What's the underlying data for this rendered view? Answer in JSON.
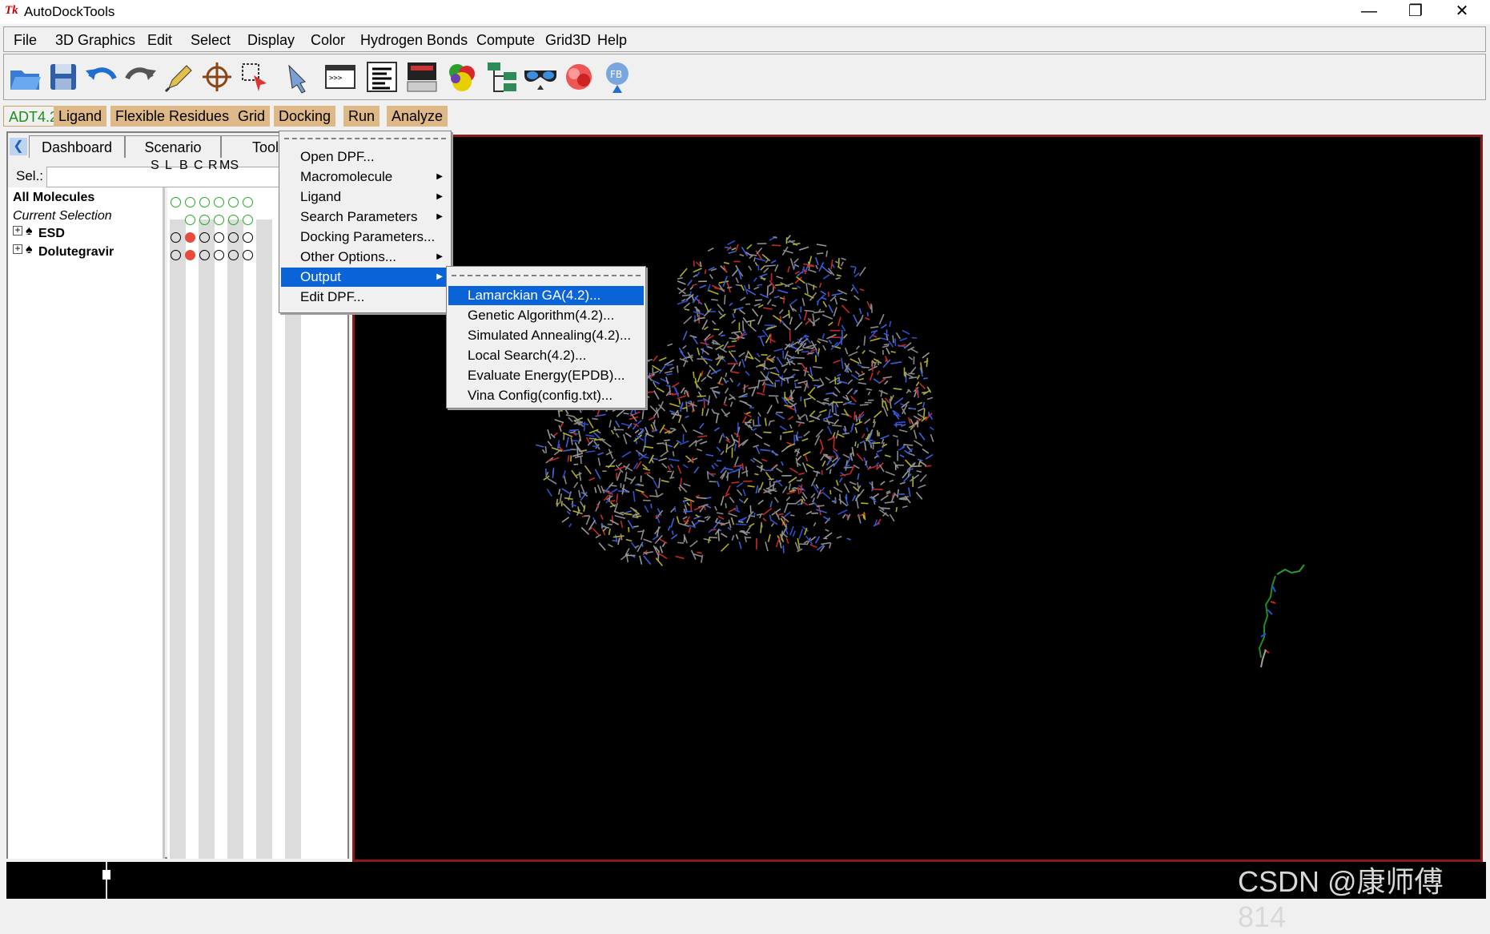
{
  "window": {
    "title": "AutoDockTools",
    "icon": "Tk",
    "minimize": "—",
    "maximize": "❐",
    "close": "✕"
  },
  "menubar": [
    "File",
    "3D Graphics",
    "Edit",
    "Select",
    "Display",
    "Color",
    "Hydrogen Bonds",
    "Compute",
    "Grid3D",
    "Help"
  ],
  "toolbar_icons": [
    "open-folder-icon",
    "save-icon",
    "undo-icon",
    "redo-icon",
    "pencil-icon",
    "target-icon",
    "select-icon",
    "hand-pick-icon",
    "python-shell-icon",
    "text-lines-icon",
    "monitor-icon",
    "color-balls-icon",
    "tree-icon",
    "stereo-glasses-icon",
    "spin-icon",
    "info-icon"
  ],
  "adt_tabs": [
    "ADT4.2",
    "Ligand",
    "Flexible Residues",
    "Grid",
    "Docking",
    "Run",
    "Analyze"
  ],
  "dashboard": {
    "tabs": [
      "Dashboard",
      "Scenario",
      "Tools"
    ],
    "sel_label": "Sel.:",
    "sel_value": "",
    "column_headers": [
      "S",
      "L",
      "B",
      "C",
      "R",
      "MS"
    ],
    "rows": [
      {
        "label": "All Molecules",
        "style": "bold"
      },
      {
        "label": "Current Selection",
        "style": "italic"
      },
      {
        "label": "ESD",
        "style": "bold",
        "expander": "+"
      },
      {
        "label": "Dolutegravir",
        "style": "bold",
        "expander": "+"
      }
    ]
  },
  "docking_menu": {
    "items": [
      "Open DPF...",
      "Macromolecule",
      "Ligand",
      "Search Parameters",
      "Docking Parameters...",
      "Other Options...",
      "Output",
      "Edit DPF..."
    ],
    "selected": "Output"
  },
  "output_submenu": {
    "items": [
      "Lamarckian GA(4.2)...",
      "Genetic Algorithm(4.2)...",
      "Simulated Annealing(4.2)...",
      "Local Search(4.2)...",
      "Evaluate Energy(EPDB)...",
      "Vina Config(config.txt)..."
    ],
    "selected": "Lamarckian GA(4.2)..."
  },
  "watermark": "CSDN @康师傅814",
  "colors": {
    "accent": "#0a64d8",
    "adt_tab_bg": "#deb887",
    "viewer_border": "#8b1a1a",
    "viewer_bg": "#000000"
  }
}
